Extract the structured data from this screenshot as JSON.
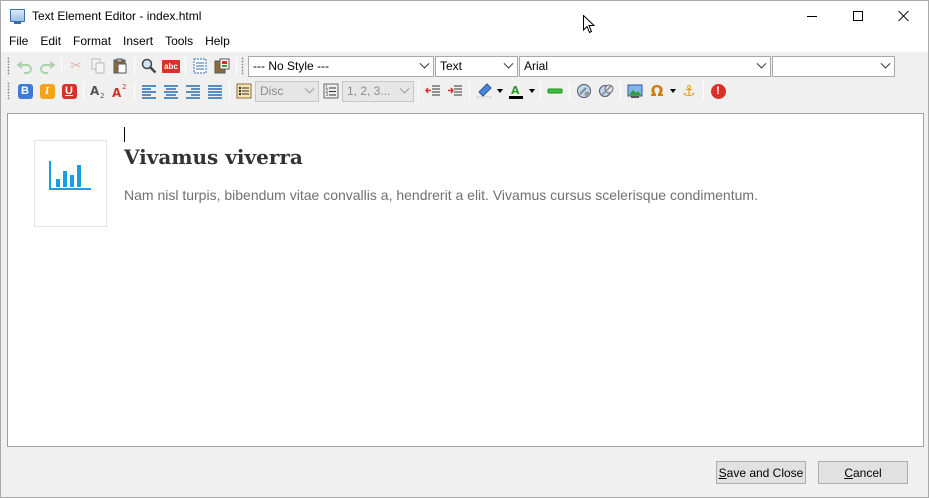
{
  "window": {
    "title": "Text Element Editor - index.html"
  },
  "menu": {
    "items": [
      "File",
      "Edit",
      "Format",
      "Insert",
      "Tools",
      "Help"
    ]
  },
  "toolbar": {
    "style_select": "--- No Style ---",
    "block_select": "Text",
    "font_select": "Arial",
    "size_select": "",
    "bullet_select": "Disc",
    "numbering_select": "1, 2, 3..."
  },
  "content": {
    "heading": "Vivamus viverra",
    "paragraph": "Nam nisl turpis, bibendum vitae convallis a, hendrerit a elit. Vivamus cursus scelerisque condimentum."
  },
  "buttons": {
    "save_first": "S",
    "save_rest": "ave and Close",
    "cancel_first": "C",
    "cancel_rest": "ancel"
  },
  "colors": {
    "chart_icon": "#1a9ee0",
    "heading": "#333333",
    "paragraph": "#707070",
    "accent_red": "#d8312a",
    "accent_blue": "#3d7bd6"
  }
}
